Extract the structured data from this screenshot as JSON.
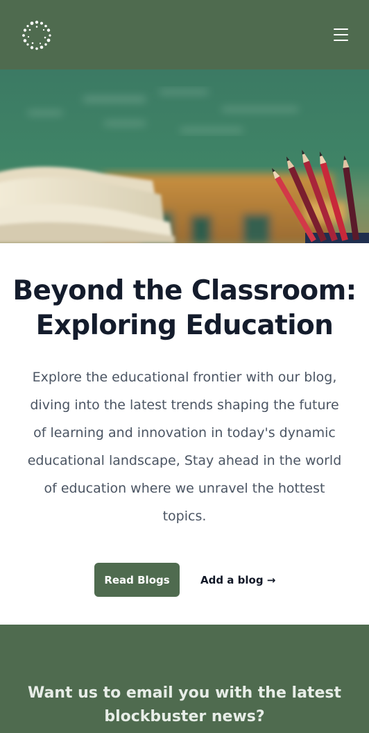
{
  "header": {
    "logo_icon": "dotted-circle-logo",
    "menu_icon": "hamburger-menu-icon"
  },
  "hero": {
    "image": "classroom-books-and-pencils"
  },
  "main": {
    "title_line1": "Beyond the Classroom:",
    "title_line2": "Exploring Education",
    "intro_lines": [
      "Explore the educational frontier with our blog,",
      "diving into the latest trends shaping the future",
      "of learning and innovation in today's dynamic",
      "educational landscape, Stay ahead in the world",
      "of education where we unravel the hottest",
      "topics."
    ],
    "read_button": "Read Blogs",
    "add_link": "Add a blog →"
  },
  "newsletter": {
    "title_line1": "Want us to email you with the latest",
    "title_line2": "blockbuster news?"
  },
  "colors": {
    "brand_green": "#4f6b4f",
    "title_text": "#141c2c",
    "body_text": "#4b5563"
  }
}
